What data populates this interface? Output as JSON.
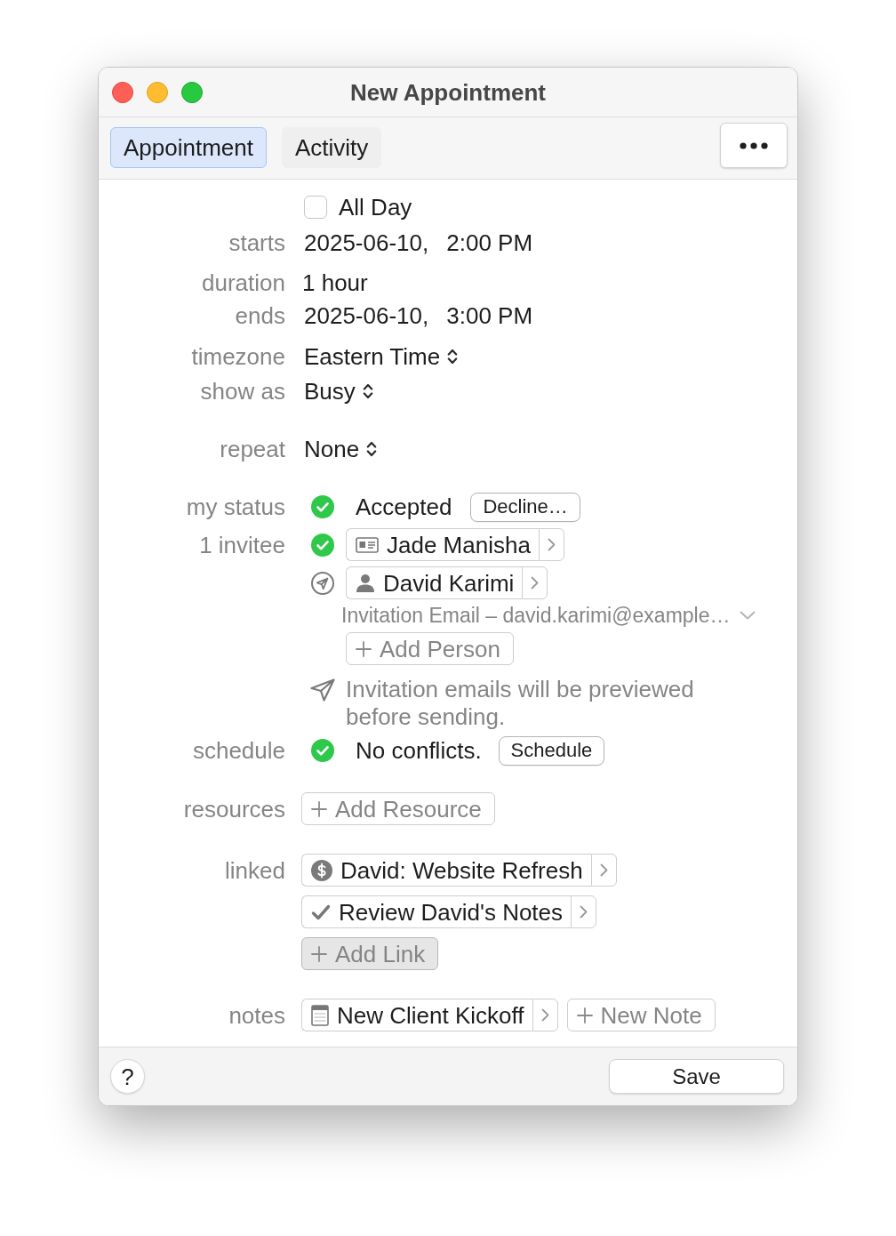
{
  "window": {
    "title": "New Appointment"
  },
  "tabs": [
    {
      "label": "Appointment",
      "selected": true
    },
    {
      "label": "Activity",
      "selected": false
    }
  ],
  "form": {
    "all_day": {
      "label": "All Day",
      "checked": false
    },
    "starts": {
      "label": "starts",
      "date": "2025-06-10,",
      "time": "2:00 PM"
    },
    "duration": {
      "label": "duration",
      "value": "1 hour"
    },
    "ends": {
      "label": "ends",
      "date": "2025-06-10,",
      "time": "3:00 PM"
    },
    "timezone": {
      "label": "timezone",
      "value": "Eastern Time"
    },
    "show_as": {
      "label": "show as",
      "value": "Busy"
    },
    "repeat": {
      "label": "repeat",
      "value": "None"
    },
    "my_status": {
      "label": "my status",
      "value": "Accepted",
      "button": "Decline…"
    },
    "invitees": {
      "label": "1 invitee",
      "people": [
        {
          "name": "Jade Manisha",
          "accepted": true,
          "kind": "card"
        },
        {
          "name": "David Karimi",
          "accepted": false,
          "kind": "person",
          "delivery": "Invitation Email – david.karimi@example…"
        }
      ],
      "add_button": "Add Person",
      "notice": "Invitation emails will be previewed before sending."
    },
    "schedule": {
      "label": "schedule",
      "value": "No conflicts.",
      "button": "Schedule"
    },
    "resources": {
      "label": "resources",
      "add_button": "Add Resource"
    },
    "linked": {
      "label": "linked",
      "items": [
        {
          "kind": "project",
          "title": "David: Website Refresh"
        },
        {
          "kind": "task",
          "title": "Review David's Notes"
        }
      ],
      "add_button": {
        "label": "Add Link",
        "pressed": true
      }
    },
    "notes": {
      "label": "notes",
      "items": [
        {
          "kind": "note",
          "title": "New Client Kickoff"
        }
      ],
      "add_button": "New Note"
    }
  },
  "footer": {
    "help": "?",
    "save": "Save"
  }
}
